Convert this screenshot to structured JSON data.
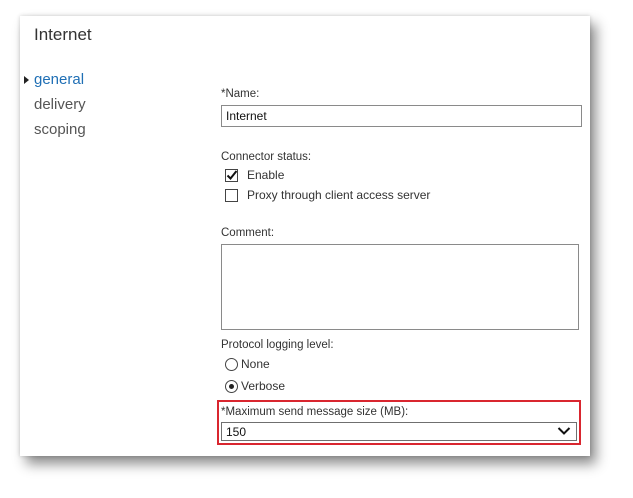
{
  "page": {
    "title": "Internet"
  },
  "nav": {
    "items": [
      {
        "label": "general",
        "active": true
      },
      {
        "label": "delivery",
        "active": false
      },
      {
        "label": "scoping",
        "active": false
      }
    ]
  },
  "form": {
    "name": {
      "label": "*Name:",
      "value": "Internet"
    },
    "connector_status": {
      "label": "Connector status:",
      "enable": {
        "label": "Enable",
        "checked": true
      },
      "proxy": {
        "label": "Proxy through client access server",
        "checked": false
      }
    },
    "comment": {
      "label": "Comment:",
      "value": ""
    },
    "protocol_logging": {
      "label": "Protocol logging level:",
      "options": [
        {
          "label": "None",
          "selected": false
        },
        {
          "label": "Verbose",
          "selected": true
        }
      ]
    },
    "max_send_size": {
      "label": "*Maximum send message size (MB):",
      "value": "150"
    }
  },
  "colors": {
    "accent": "#1f6fb5",
    "highlight": "#d9262f"
  },
  "icons": {
    "nav_selected": "triangle-right-icon",
    "checkbox_checked": "checkmark-icon",
    "dropdown": "chevron-down-icon"
  }
}
